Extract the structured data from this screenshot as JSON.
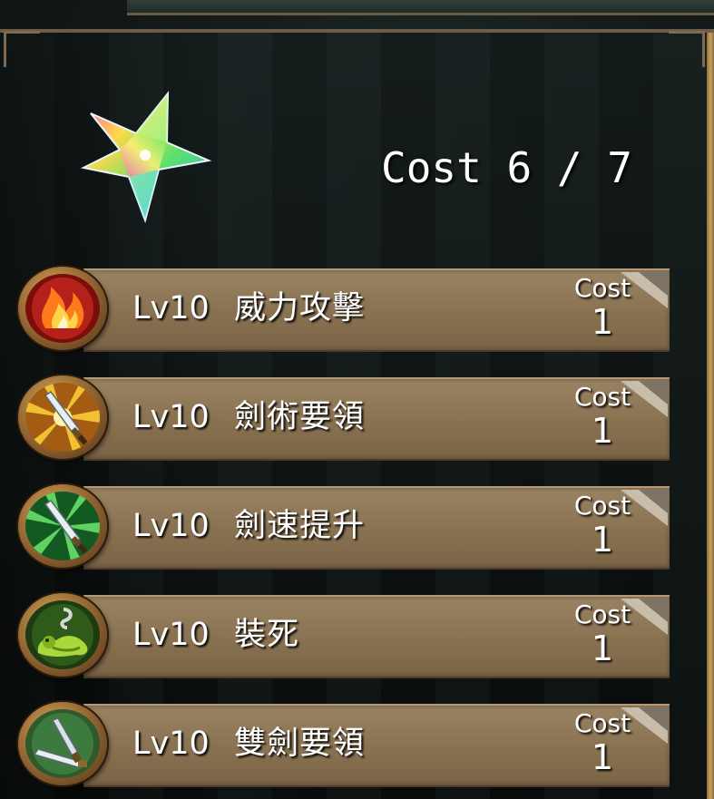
{
  "header": {
    "cost_label": "Cost",
    "cost_used": "6",
    "cost_separator": "/",
    "cost_max": "7",
    "cost_text": "Cost 6 / 7",
    "crystal_icon": "rainbow-star-crystal-icon"
  },
  "skills": [
    {
      "level": "Lv10",
      "name": "威力攻擊",
      "cost_label": "Cost",
      "cost": "1",
      "icon": "fire-icon",
      "icon_color": "#c8231a"
    },
    {
      "level": "Lv10",
      "name": "劍術要領",
      "cost_label": "Cost",
      "cost": "1",
      "icon": "sword-burst-icon",
      "icon_color": "#c89a1e"
    },
    {
      "level": "Lv10",
      "name": "劍速提升",
      "cost_label": "Cost",
      "cost": "1",
      "icon": "sword-speed-icon",
      "icon_color": "#2f9a3a"
    },
    {
      "level": "Lv10",
      "name": "裝死",
      "cost_label": "Cost",
      "cost": "1",
      "icon": "play-dead-icon",
      "icon_color": "#7fb21f"
    },
    {
      "level": "Lv10",
      "name": "雙劍要領",
      "cost_label": "Cost",
      "cost": "1",
      "icon": "dual-sword-icon",
      "icon_color": "#3d7a3d"
    }
  ],
  "colors": {
    "bar": "#8a7352",
    "frame": "#7e6a52",
    "text": "#ffffff"
  }
}
